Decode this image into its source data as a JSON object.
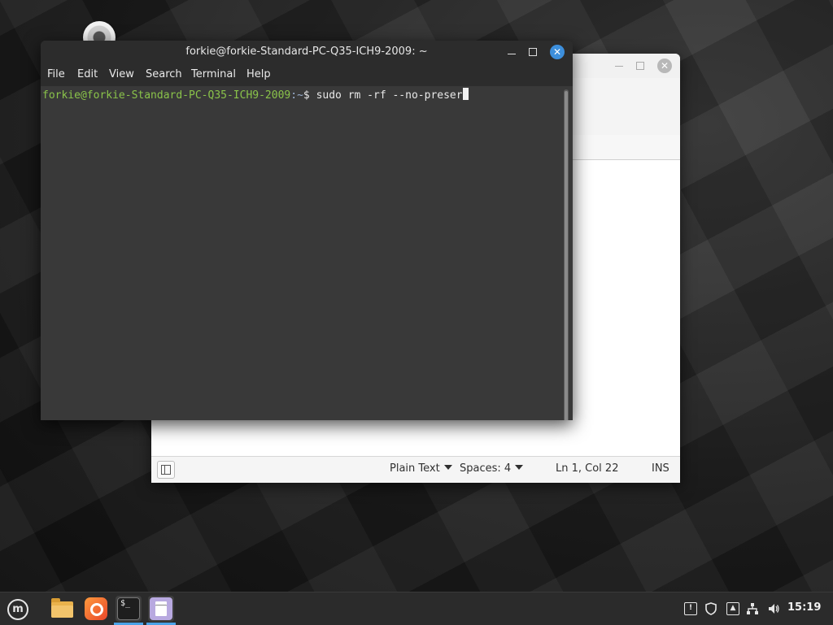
{
  "terminal": {
    "title": "forkie@forkie-Standard-PC-Q35-ICH9-2009: ~",
    "menu": [
      "File",
      "Edit",
      "View",
      "Search",
      "Terminal",
      "Help"
    ],
    "prompt_user_host": "forkie@forkie-Standard-PC-Q35-ICH9-2009",
    "prompt_path": ":~",
    "prompt_symbol": "$ ",
    "command": "sudo rm -rf --no-preser"
  },
  "editor": {
    "status": {
      "language": "Plain Text",
      "indent": "Spaces: 4",
      "position": "Ln 1, Col 22",
      "mode": "INS"
    }
  },
  "window_controls": {
    "close_glyph": "✕"
  },
  "taskbar": {
    "menu_logo": "m",
    "terminal_icon_text": "$_",
    "clock": "15:19"
  },
  "colors": {
    "prompt_user": "#8ac34a",
    "accent_blue": "#3d8fdc",
    "terminal_bg": "#393939"
  }
}
